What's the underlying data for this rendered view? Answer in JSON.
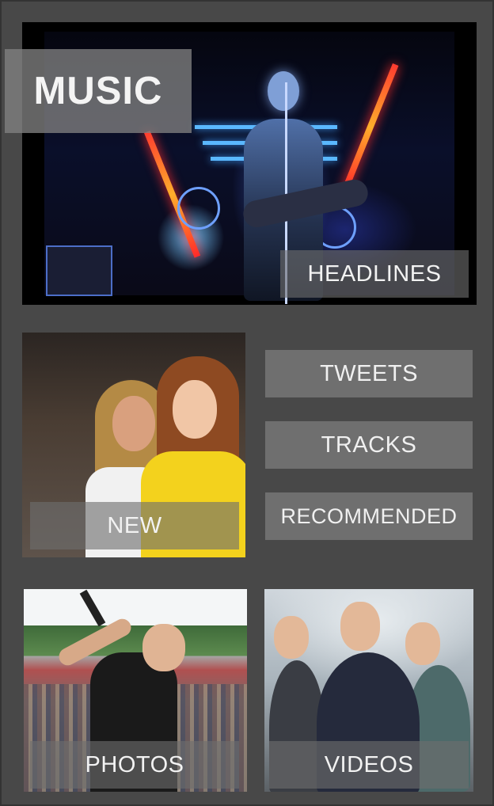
{
  "app": {
    "title": "MUSIC"
  },
  "tiles": {
    "headlines": {
      "label": "HEADLINES",
      "image": "concert-stage-photo"
    },
    "new": {
      "label": "NEW",
      "image": "two-singers-photo"
    },
    "photos": {
      "label": "PHOTOS",
      "image": "performer-with-mic-photo"
    },
    "videos": {
      "label": "VIDEOS",
      "image": "band-portrait-photo"
    }
  },
  "menu": {
    "tweets": "TWEETS",
    "tracks": "TRACKS",
    "recommended": "RECOMMENDED"
  },
  "colors": {
    "background": "#484848",
    "button": "#6f6f6f",
    "text": "#f0f0f0"
  }
}
